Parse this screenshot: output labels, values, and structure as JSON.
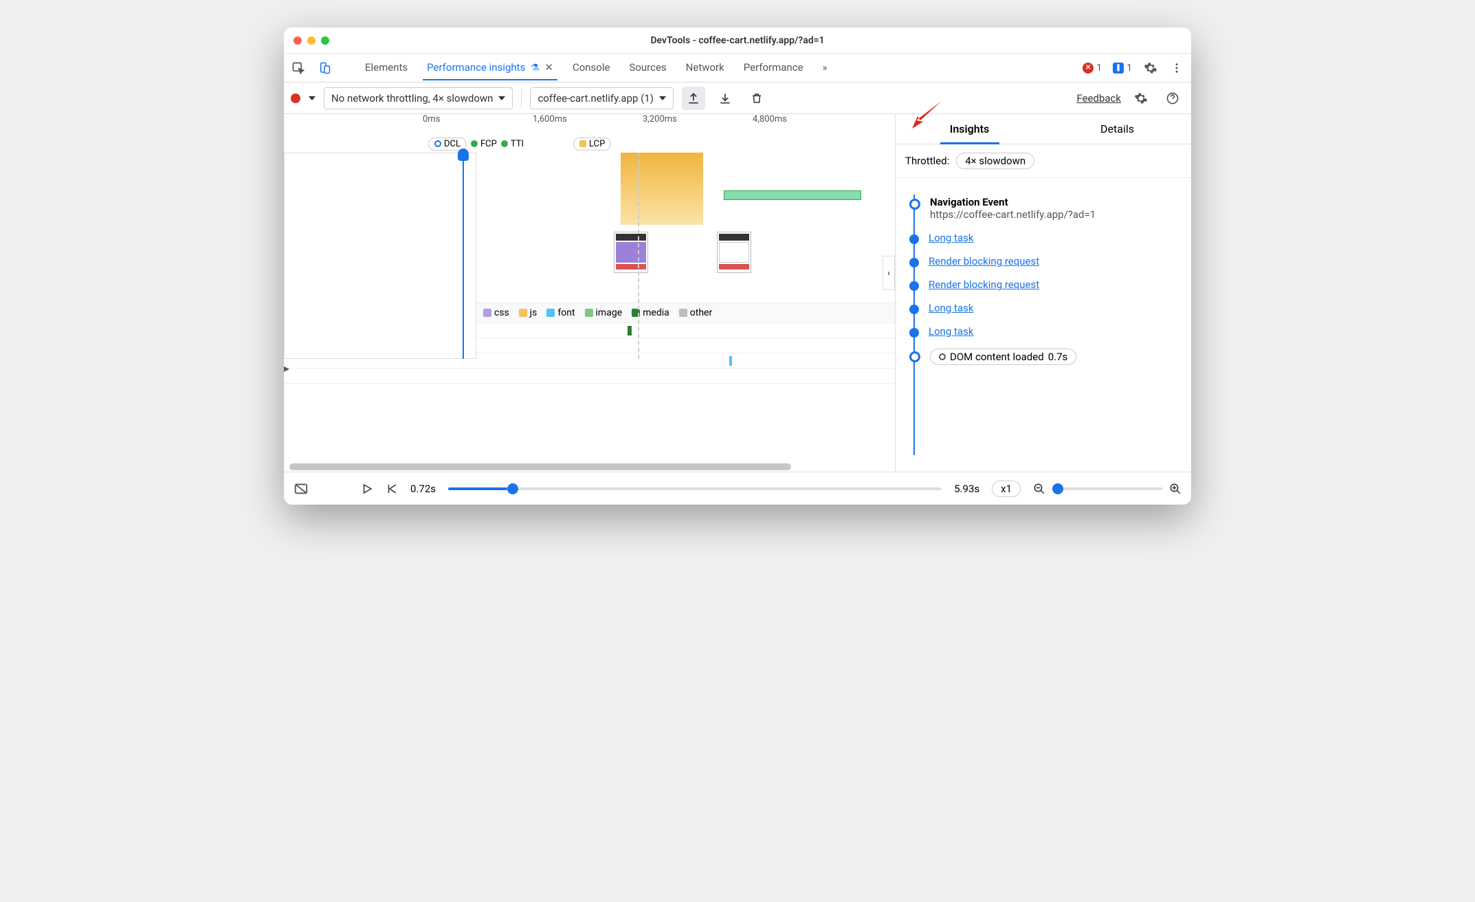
{
  "window": {
    "title": "DevTools - coffee-cart.netlify.app/?ad=1"
  },
  "tabs": {
    "elements": "Elements",
    "perf_insights": "Performance insights",
    "console": "Console",
    "sources": "Sources",
    "network": "Network",
    "performance": "Performance",
    "more": "»",
    "errors": "1",
    "messages": "1"
  },
  "toolbar": {
    "throttle_select": "No network throttling, 4× slowdown",
    "target_select": "coffee-cart.netlify.app (1)",
    "feedback": "Feedback"
  },
  "ruler": {
    "t0": "0ms",
    "t1": "1,600ms",
    "t2": "3,200ms",
    "t3": "4,800ms"
  },
  "markers": {
    "dcl": "DCL",
    "fcp": "FCP",
    "tti": "TTI",
    "lcp": "LCP"
  },
  "legend": {
    "css": "css",
    "js": "js",
    "font": "font",
    "image": "image",
    "media": "media",
    "other": "other"
  },
  "right": {
    "tab_insights": "Insights",
    "tab_details": "Details",
    "throttled_label": "Throttled:",
    "throttled_value": "4× slowdown",
    "nav_event": "Navigation Event",
    "nav_url": "https://coffee-cart.netlify.app/?ad=1",
    "items": [
      "Long task",
      "Render blocking request",
      "Render blocking request",
      "Long task",
      "Long task"
    ],
    "dcl_event": "DOM content loaded",
    "dcl_time": "0.7s"
  },
  "bottom": {
    "time_start": "0.72s",
    "time_end": "5.93s",
    "speed": "x1"
  },
  "colors": {
    "css": "#b39ddb",
    "js": "#f5c35a",
    "font": "#4fc3f7",
    "image": "#81c784",
    "media": "#2e7d32",
    "other": "#bdbdbd",
    "blue": "#1a73e8",
    "green": "#34a853"
  }
}
